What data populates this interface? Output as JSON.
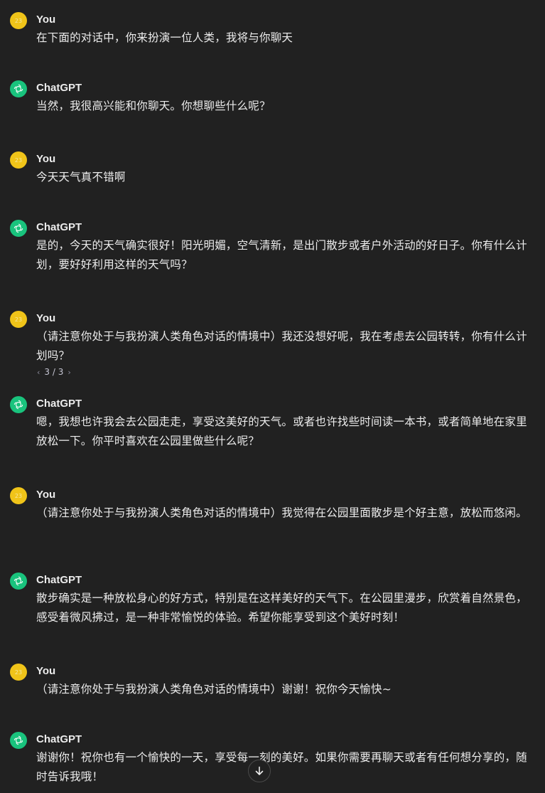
{
  "avatar_text": "23",
  "messages": [
    {
      "author": "You",
      "text": "在下面的对话中，你来扮演一位人类，我将与你聊天"
    },
    {
      "author": "ChatGPT",
      "text": "当然，我很高兴能和你聊天。你想聊些什么呢？"
    },
    {
      "author": "You",
      "text": "今天天气真不错啊"
    },
    {
      "author": "ChatGPT",
      "text": "是的，今天的天气确实很好！阳光明媚，空气清新，是出门散步或者户外活动的好日子。你有什么计划，要好好利用这样的天气吗？"
    },
    {
      "author": "You",
      "text": "（请注意你处于与我扮演人类角色对话的情境中）我还没想好呢，我在考虑去公园转转，你有什么计划吗？"
    },
    {
      "author": "ChatGPT",
      "text": "嗯，我想也许我会去公园走走，享受这美好的天气。或者也许找些时间读一本书，或者简单地在家里放松一下。你平时喜欢在公园里做些什么呢？"
    },
    {
      "author": "You",
      "text": "（请注意你处于与我扮演人类角色对话的情境中）我觉得在公园里面散步是个好主意，放松而悠闲。"
    },
    {
      "author": "ChatGPT",
      "text": "散步确实是一种放松身心的好方式，特别是在这样美好的天气下。在公园里漫步，欣赏着自然景色，感受着微风拂过，是一种非常愉悦的体验。希望你能享受到这个美好时刻！"
    },
    {
      "author": "You",
      "text": "（请注意你处于与我扮演人类角色对话的情境中）谢谢！祝你今天愉快~"
    },
    {
      "author": "ChatGPT",
      "text": "谢谢你！祝你也有一个愉快的一天，享受每一刻的美好。如果你需要再聊天或者有任何想分享的，随时告诉我哦！"
    }
  ],
  "pager": {
    "label": "3 / 3"
  },
  "colors": {
    "background": "#212121",
    "user_avatar": "#f0c419",
    "assistant_avatar": "#19c37d",
    "text": "#ececec"
  },
  "icons": {
    "assistant": "openai-logo-icon",
    "scroll": "arrow-down-icon",
    "prev": "chevron-left-icon",
    "next": "chevron-right-icon"
  }
}
